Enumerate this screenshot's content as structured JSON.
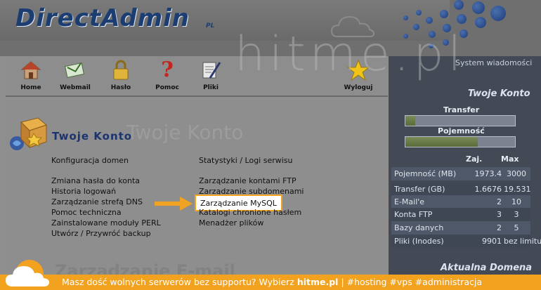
{
  "header": {
    "logo": "DirectAdmin",
    "logo_suffix": "PL",
    "watermark": "hitme.pl"
  },
  "toolbar": {
    "items": [
      {
        "label": "Home",
        "icon": "home-icon"
      },
      {
        "label": "Webmail",
        "icon": "webmail-icon"
      },
      {
        "label": "Hasło",
        "icon": "lock-icon"
      },
      {
        "label": "Pomoc",
        "icon": "help-icon"
      },
      {
        "label": "Pliki",
        "icon": "files-icon"
      },
      {
        "label": "Wyloguj",
        "icon": "logout-star-icon"
      }
    ]
  },
  "system_messages": "System wiadomości",
  "main": {
    "section_title": "Twoje Konto",
    "section_ghost": "Twoje Konto",
    "left_links": [
      "Konfiguracja domen",
      "Zmiana hasła do konta",
      "Historia logowań",
      "Zarządzanie strefą DNS",
      "Pomoc techniczna",
      "Zainstalowane moduły PERL",
      "Utwórz / Przywróć backup"
    ],
    "right_links": [
      "Statystyki / Logi serwisu",
      "Zarządzanie kontami FTP",
      "Zarządzanie subdomenami",
      "Zarządzanie MySQL",
      "Katalogi chronione hasłem",
      "Menadżer plików"
    ],
    "bottom_ghost": "Zarządzanie E-mail"
  },
  "account_panel": {
    "title": "Twoje Konto",
    "transfer_label": "Transfer",
    "transfer_fraction": 0.09,
    "capacity_label": "Pojemność",
    "capacity_fraction": 0.66,
    "col_used": "Zaj.",
    "col_max": "Max",
    "rows": [
      {
        "name": "Pojemność (MB)",
        "used": "1973.4",
        "max": "3000"
      },
      {
        "name": "Transfer (GB)",
        "used": "1.6676",
        "max": "19.531"
      },
      {
        "name": "E-Mail'e",
        "used": "2",
        "max": "10"
      },
      {
        "name": "Konta FTP",
        "used": "3",
        "max": "3"
      },
      {
        "name": "Bazy danych",
        "used": "2",
        "max": "5"
      },
      {
        "name": "Pliki (Inodes)",
        "used": "9901",
        "max": "bez limitu"
      }
    ],
    "domain_title": "Aktualna Domena"
  },
  "footer": {
    "text": "Masz dość wolnych serwerów bez supportu? Wybierz ",
    "brand": "hitme.pl",
    "separator": " |   ",
    "tags": "#hosting #vps #administracja"
  },
  "colors": {
    "accent_orange": "#f2a21f",
    "logo_blue": "#1c3d72",
    "panel_dark": "#434a56"
  }
}
